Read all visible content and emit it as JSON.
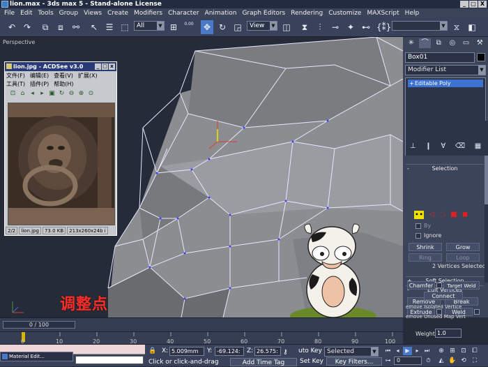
{
  "window": {
    "title": "lion.max - 3ds max 5 - Stand-alone License",
    "btn_min": "_",
    "btn_max": "□",
    "btn_close": "X"
  },
  "menu": [
    "File",
    "Edit",
    "Tools",
    "Group",
    "Views",
    "Create",
    "Modifiers",
    "Character",
    "Animation",
    "Graph Editors",
    "Rendering",
    "Customize",
    "MAXScript",
    "Help"
  ],
  "toolbar": {
    "selection_filter": "All",
    "ref_coord": "View",
    "named_set": "",
    "undo_icon": "undo-icon",
    "redo_icon": "redo-icon",
    "move_icon": "move-icon",
    "spinner_value": "0.00"
  },
  "viewport": {
    "label": "Perspective",
    "overlay_text": "调整点",
    "axis": "x y z"
  },
  "acdsee": {
    "title": "lion.jpg - ACDSee v3.0",
    "menu_row1": [
      "文件(F)",
      "编辑(E)",
      "查看(V)",
      "扩展(X)"
    ],
    "menu_row2": [
      "工具(T)",
      "插件(P)",
      "帮助(H)"
    ],
    "status": [
      "2/2",
      "lion.jpg",
      "73.0 KB",
      "213x260x24b i"
    ]
  },
  "command_panel": {
    "object_name": "Box01",
    "modifier_list": "Modifier List",
    "stack_item": "Editable Poly",
    "selection_rollout": "Selection",
    "by_vertex": "By",
    "ignore_backfacing": "Ignore",
    "shrink": "Shrink",
    "grow": "Grow",
    "ring": "Ring",
    "loop": "Loop",
    "selection_info": "2 Vertices Selected",
    "soft_selection": "Soft Selection",
    "edit_vertices": "Edit Vertices",
    "remove": "Remove",
    "break": "Break",
    "extrude": "Extrude",
    "weld": "Weld",
    "chamfer": "Chamfer",
    "target_weld": "Target Weld",
    "connect": "Connect",
    "remove_isolated": "emove Isolated Vertice",
    "remove_unused": "emove Unused Map Vert",
    "weight_label": "Weight:",
    "weight_value": "1.0",
    "plus": "+",
    "minus": "-"
  },
  "timeline": {
    "slider": "0 / 100",
    "ticks": [
      "0",
      "10",
      "20",
      "30",
      "40",
      "50",
      "60",
      "70",
      "80",
      "90",
      "100"
    ]
  },
  "status": {
    "taskbar_item": "Material Edit...",
    "x_label": "X:",
    "x": "5.009mm",
    "y_label": "Y:",
    "y": "-69.124:",
    "z_label": "Z:",
    "z": "26.575:",
    "prompt": "Click or click-and-drag",
    "add_time_tag": "Add Time Tag",
    "auto_key": "uto Key",
    "set_key": "Set Key",
    "selected": "Selected",
    "key_filters": "Key Filters...",
    "frame": "0"
  }
}
